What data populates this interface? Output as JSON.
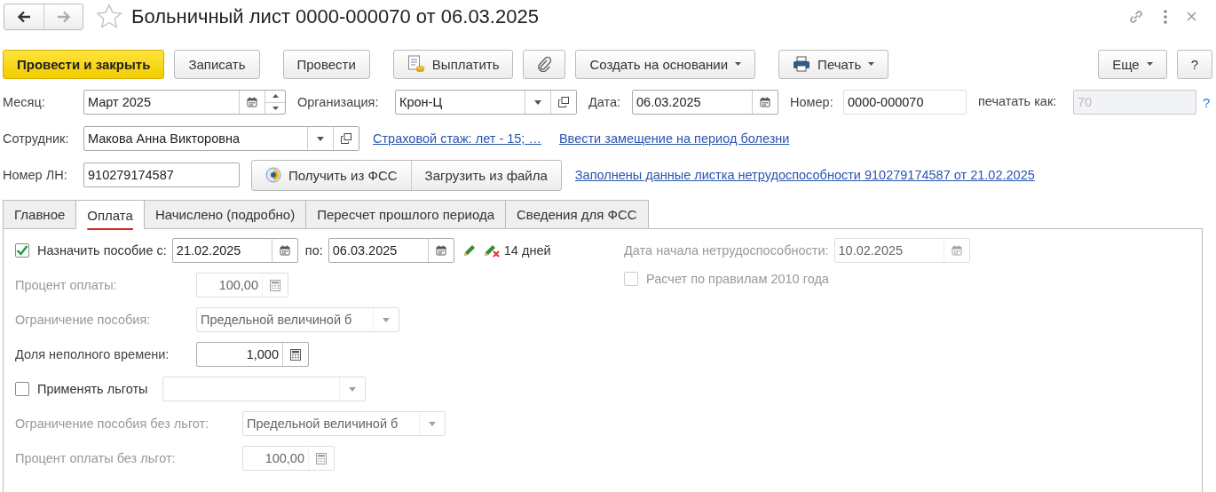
{
  "window": {
    "title": "Больничный лист 0000-000070 от 06.03.2025",
    "favorite": false
  },
  "nav": [
    {
      "kind": "back",
      "disabled": false
    },
    {
      "kind": "forward",
      "disabled": true
    }
  ],
  "toolbar": {
    "left": [
      {
        "label": "Провести и закрыть",
        "kind": "primary"
      },
      {
        "label": "Записать",
        "kind": "plain"
      },
      {
        "label": "Провести",
        "kind": "plain"
      },
      {
        "label": "Выплатить",
        "kind": "pay"
      },
      {
        "kind": "attach"
      },
      {
        "label": "Создать на основании",
        "kind": "menu"
      },
      {
        "label": "Печать",
        "kind": "print"
      }
    ],
    "right": [
      {
        "label": "Еще",
        "kind": "menu"
      },
      {
        "label": "?",
        "kind": "plain"
      }
    ]
  },
  "header": {
    "month": {
      "label": "Месяц:",
      "value": "Март 2025"
    },
    "organization": {
      "label": "Организация:",
      "value": "Крон-Ц"
    },
    "date": {
      "label": "Дата:",
      "value": "06.03.2025"
    },
    "number": {
      "label": "Номер:",
      "value": "0000-000070"
    },
    "print_as": {
      "label": "печатать как:",
      "value": "70",
      "disabled": true,
      "help": "?"
    },
    "employee": {
      "label": "Сотрудник:",
      "value": "Макова Анна Викторовна"
    },
    "links": [
      "Страховой стаж: лет - 15; …",
      "Ввести замещение на период болезни"
    ],
    "sick_leave_number": {
      "label": "Номер ЛН:",
      "value": "910279174587"
    },
    "fss_buttons": [
      {
        "label": "Получить из ФСС",
        "kind": "fss"
      },
      {
        "label": "Загрузить из файла",
        "kind": "plain"
      }
    ],
    "filled_link": "Заполнены данные листка нетрудоспособности 910279174587 от 21.02.2025"
  },
  "tabs": [
    {
      "label": "Главное",
      "selected": false
    },
    {
      "label": "Оплата",
      "selected": true
    },
    {
      "label": "Начислено (подробно)",
      "selected": false
    },
    {
      "label": "Пересчет прошлого периода",
      "selected": false
    },
    {
      "label": "Сведения для ФСС",
      "selected": false
    }
  ],
  "payment": {
    "assign": {
      "label": "Назначить пособие с:",
      "checked": true,
      "from": "21.02.2025",
      "to_label": "по:",
      "to": "06.03.2025",
      "days": "14 дней"
    },
    "percent": {
      "label": "Процент оплаты:",
      "value": "100,00",
      "disabled": true
    },
    "limit": {
      "label": "Ограничение пособия:",
      "value": "Предельной величиной б",
      "disabled": true
    },
    "part_time": {
      "label": "Доля неполного времени:",
      "value": "1,000",
      "disabled": false
    },
    "benefits": {
      "label": "Применять льготы",
      "checked": false
    },
    "limit_no_benefits": {
      "label": "Ограничение пособия без льгот:",
      "value": "Предельной величиной б",
      "disabled": true
    },
    "percent_no_benefits": {
      "label": "Процент оплаты без льгот:",
      "value": "100,00",
      "disabled": true
    },
    "incapacity_start": {
      "label": "Дата начала нетрудоспособности:",
      "value": "10.02.2025",
      "disabled": true
    },
    "rules_2010": {
      "label": "Расчет по правилам 2010 года",
      "checked": false,
      "disabled": true
    }
  }
}
